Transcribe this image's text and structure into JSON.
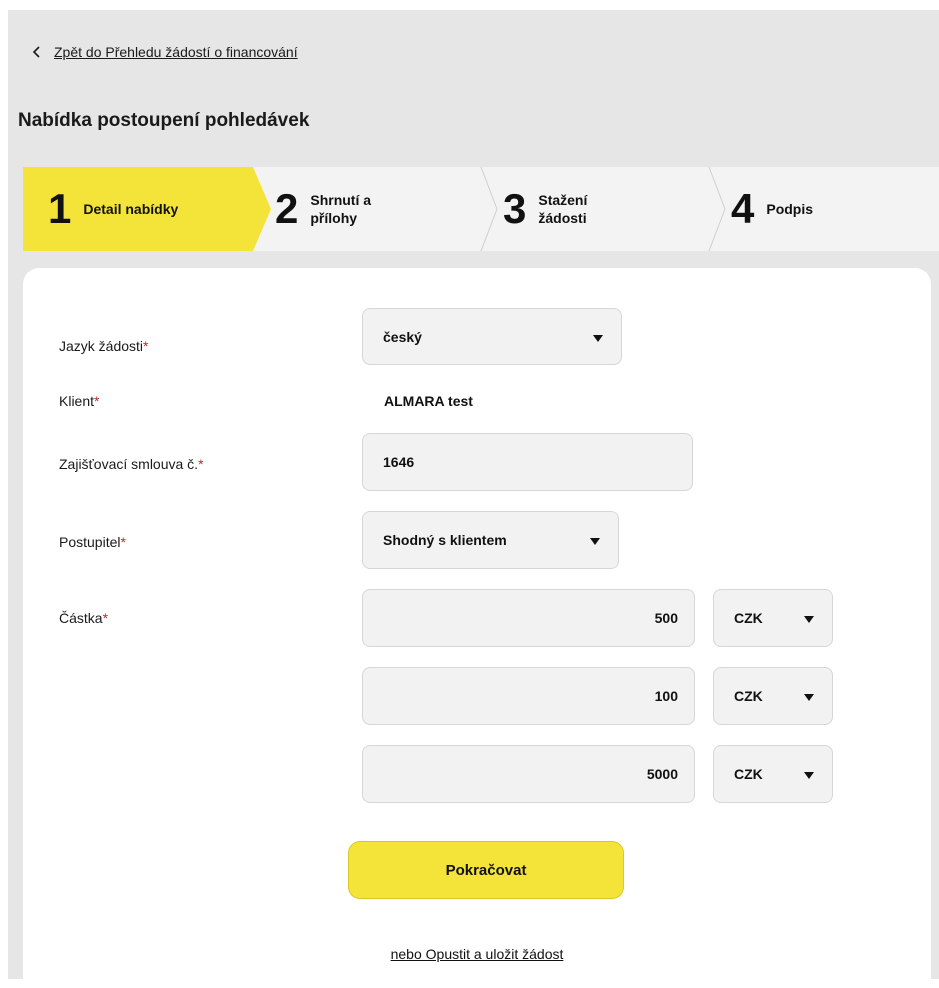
{
  "nav": {
    "back_label": "Zpět do Přehledu žádostí o financování"
  },
  "page": {
    "title": "Nabídka postoupení pohledávek"
  },
  "stepper": {
    "colors": {
      "active": "#f4e43a",
      "inactive": "#f3f3f3"
    },
    "steps": [
      {
        "number": "1",
        "label": "Detail nabídky",
        "active": true
      },
      {
        "number": "2",
        "label": "Shrnutí a\npřílohy",
        "active": false
      },
      {
        "number": "3",
        "label": "Stažení\nžádosti",
        "active": false
      },
      {
        "number": "4",
        "label": "Podpis",
        "active": false
      }
    ]
  },
  "form": {
    "required_mark": "*",
    "language": {
      "label": "Jazyk žádosti",
      "value": "český"
    },
    "client": {
      "label": "Klient",
      "value": "ALMARA test"
    },
    "contract": {
      "label": "Zajišťovací smlouva č.",
      "value": "1646"
    },
    "assignor": {
      "label": "Postupitel",
      "value": "Shodný s klientem"
    },
    "amount": {
      "label": "Částka",
      "rows": [
        {
          "value": "500",
          "currency": "CZK"
        },
        {
          "value": "100",
          "currency": "CZK"
        },
        {
          "value": "5000",
          "currency": "CZK"
        }
      ]
    }
  },
  "actions": {
    "continue_label": "Pokračovat",
    "save_exit_label": "nebo Opustit a uložit žádost"
  }
}
